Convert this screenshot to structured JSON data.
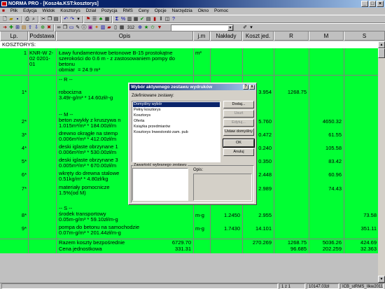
{
  "window": {
    "title": "NORMA PRO - [Kosz4a.KST:kosztorys]"
  },
  "menu": [
    "Plik",
    "Edycja",
    "Widok",
    "Kosztorys",
    "Dział",
    "Pozycja",
    "RMS",
    "Ceny",
    "Opcje",
    "Narzędzia",
    "Okno",
    "Pomoc"
  ],
  "toolbar": {
    "font_size_value": "312"
  },
  "columns": [
    "Lp.",
    "Podstawa",
    "Opis",
    "j.m",
    "Nakłady",
    "Koszt jed.",
    "R",
    "M",
    "S"
  ],
  "section_label": "KOSZTORYS:",
  "rows": [
    {
      "lp": "1",
      "podstawa": "KNR-W 2-\n02 0201-\n01",
      "opis": "Ławy fundamentowe betonowe B-15 prostokątne\nszerokości do 0.6 m - z zastosowaniem pompy do\nbetonu\nobmiar  = 24.9 m³",
      "jm": "m³",
      "naklady": "",
      "koszt": "",
      "r": "",
      "m": "",
      "s": ""
    },
    {
      "lp": "",
      "podstawa": "",
      "opis": "-- R --",
      "jm": "",
      "naklady": "",
      "koszt": "",
      "r": "",
      "m": "",
      "s": ""
    },
    {
      "lp": "1*",
      "podstawa": "",
      "opis": "robocizna\n3.49r-g/m³ * 14.60zł/r-g",
      "jm": "",
      "naklady": "",
      "koszt": "3.954",
      "r": "1268.75",
      "m": "",
      "s": ""
    },
    {
      "lp": "",
      "podstawa": "",
      "opis": "-- M --",
      "jm": "",
      "naklady": "",
      "koszt": "",
      "r": "",
      "m": "",
      "s": ""
    },
    {
      "lp": "2*",
      "podstawa": "",
      "opis": "beton zwykły z kruszywa n\n1.015m³/m³ * 184.00zł/m",
      "jm": "",
      "naklady": "",
      "koszt": "5.760",
      "r": "",
      "m": "4650.32",
      "s": ""
    },
    {
      "lp": "3*",
      "podstawa": "",
      "opis": "drewno okrągłe na stemp\n0.006m³/m³ * 412.00zł/m",
      "jm": "",
      "naklady": "",
      "koszt": "0.472",
      "r": "",
      "m": "61.55",
      "s": ""
    },
    {
      "lp": "4*",
      "podstawa": "",
      "opis": "deski iglaste obrzynane 1\n0.006m³/m³ * 530.00zł/m",
      "jm": "",
      "naklady": "",
      "koszt": "0.240",
      "r": "",
      "m": "105.58",
      "s": ""
    },
    {
      "lp": "5*",
      "podstawa": "",
      "opis": "deski iglaste obrzynane 3\n0.005m³/m³ * 670.00zł/m",
      "jm": "",
      "naklady": "",
      "koszt": "0.350",
      "r": "",
      "m": "83.42",
      "s": ""
    },
    {
      "lp": "6*",
      "podstawa": "",
      "opis": "wkręty do drewna stalowe\n0.51kg/m³ * 4.80zł/kg",
      "jm": "",
      "naklady": "",
      "koszt": "2.448",
      "r": "",
      "m": "60.96",
      "s": ""
    },
    {
      "lp": "7*",
      "podstawa": "",
      "opis": "materiały pomocnicze\n1.5%(od M)",
      "jm": "",
      "naklady": "",
      "koszt": "2.989",
      "r": "",
      "m": "74.43",
      "s": ""
    },
    {
      "lp": "",
      "podstawa": "",
      "opis": "-- S --",
      "jm": "",
      "naklady": "",
      "koszt": "",
      "r": "",
      "m": "",
      "s": ""
    },
    {
      "lp": "8*",
      "podstawa": "",
      "opis": "środek transportowy\n0.05m-g/m³ * 59.10zł/m-g",
      "jm": "m-g",
      "naklady": "1.2450",
      "koszt": "2.955",
      "r": "",
      "m": "",
      "s": "73.58"
    },
    {
      "lp": "9*",
      "podstawa": "",
      "opis": "pompa do betonu na samochodzie\n0.07m-g/m³ * 201.44zł/m-g",
      "jm": "m-g",
      "naklady": "1.7430",
      "koszt": "14.101",
      "r": "",
      "m": "",
      "s": "351.11"
    }
  ],
  "totals": {
    "razem_label": "Razem koszty bezpośrednie",
    "razem_opis_value": "6729.70",
    "razem_koszt": "270.269",
    "razem_r": "1268.75",
    "razem_m": "5036.26",
    "razem_s": "424.69",
    "cena_label": "Cena jednostkowa",
    "cena_opis_value": "331.31",
    "cena_r": "96.685",
    "cena_m": "202.259",
    "cena_s": "32.363"
  },
  "dialog": {
    "title": "Wybór aktywnego zestawu wydruków",
    "help_btn": "?",
    "close_btn": "x",
    "defined_label": "Zdefiniowane zestawy:",
    "sets": [
      "Domyślny wybór",
      "Pełny kosztorys",
      "Kosztorys",
      "Oferta",
      "Książka przedmiarów",
      "Kosztorys Inwestorski-zam. pub"
    ],
    "selected_index": 0,
    "buttons": {
      "add": "Dodaj...",
      "delete": "Usuń",
      "edit": "Edytuj...",
      "set_default": "Ustaw domyślny",
      "ok": "OK",
      "cancel": "Anuluj"
    },
    "contents_label": "Zawartość wybranego zestawu",
    "desc_label": "Opis:"
  },
  "status": {
    "pages": "1 z 1",
    "value": "10147.03zł",
    "catalog": "ICB_stRMS_IIkw2011"
  }
}
